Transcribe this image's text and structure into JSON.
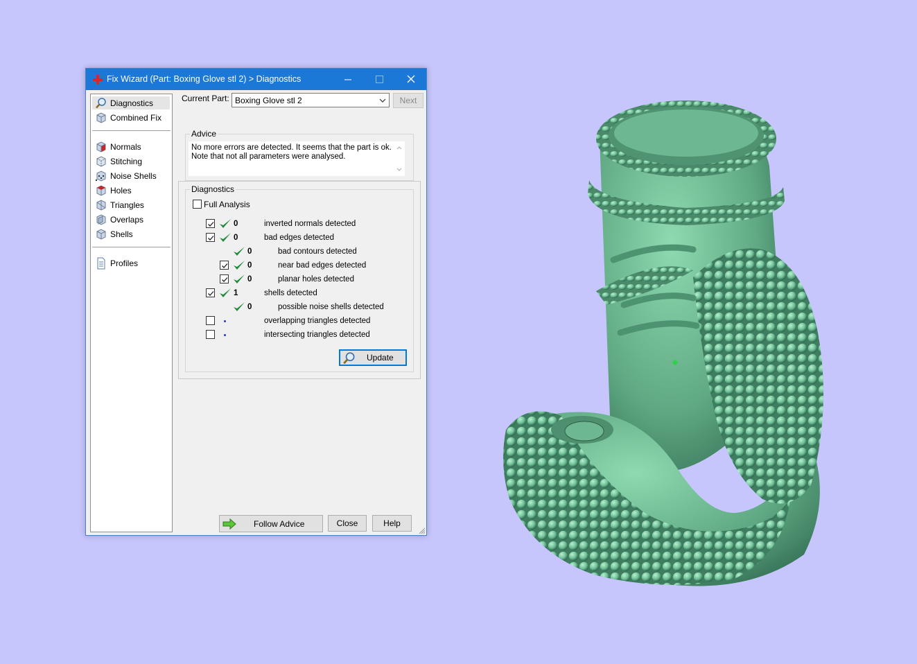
{
  "colors": {
    "desktop": "#c6c6fc",
    "titlebar": "#1b78d6",
    "model": "#6fbf97",
    "check_green": "#1f8a3b"
  },
  "window": {
    "title": "Fix Wizard (Part: Boxing Glove stl 2) > Diagnostics",
    "controls": [
      "minimize-icon",
      "maximize-icon",
      "close-icon"
    ]
  },
  "sidebar": {
    "items": [
      {
        "label": "Diagnostics",
        "icon": "magnifier-icon",
        "selected": true
      },
      {
        "label": "Combined Fix",
        "icon": "cube-icon"
      },
      {
        "label": "Normals",
        "icon": "cube-red-face-icon"
      },
      {
        "label": "Stitching",
        "icon": "cube-stitch-icon"
      },
      {
        "label": "Noise Shells",
        "icon": "cube-dots-icon"
      },
      {
        "label": "Holes",
        "icon": "cube-red-hole-icon"
      },
      {
        "label": "Triangles",
        "icon": "triangle-cube-icon"
      },
      {
        "label": "Overlaps",
        "icon": "cube-overlap-icon"
      },
      {
        "label": "Shells",
        "icon": "cube-shells-icon"
      },
      {
        "label": "Profiles",
        "icon": "document-icon"
      }
    ]
  },
  "current_part": {
    "label": "Current Part:",
    "value": "Boxing Glove stl 2",
    "next_label": "Next"
  },
  "advice": {
    "title": "Advice",
    "text_line1": "No more errors are detected. It seems that the part is ok.",
    "text_line2": "Note that not all parameters were analysed."
  },
  "diagnostics": {
    "title": "Diagnostics",
    "full_analysis_label": "Full Analysis",
    "full_analysis_checked": false,
    "rows": [
      {
        "checked": true,
        "status": "ok",
        "count": "0",
        "label": "inverted normals detected",
        "level": 0,
        "has_checkbox": true
      },
      {
        "checked": true,
        "status": "ok",
        "count": "0",
        "label": "bad edges detected",
        "level": 0,
        "has_checkbox": true
      },
      {
        "checked": false,
        "status": "ok",
        "count": "0",
        "label": "bad contours detected",
        "level": 1,
        "has_checkbox": false
      },
      {
        "checked": true,
        "status": "ok",
        "count": "0",
        "label": "near bad edges detected",
        "level": 1,
        "has_checkbox": true
      },
      {
        "checked": true,
        "status": "ok",
        "count": "0",
        "label": "planar holes detected",
        "level": 1,
        "has_checkbox": true
      },
      {
        "checked": true,
        "status": "ok",
        "count": "1",
        "label": "shells detected",
        "level": 0,
        "has_checkbox": true
      },
      {
        "checked": false,
        "status": "ok",
        "count": "0",
        "label": "possible noise shells detected",
        "level": 1,
        "has_checkbox": false
      },
      {
        "checked": false,
        "status": "pending",
        "count": "",
        "label": "overlapping triangles detected",
        "level": 0,
        "has_checkbox": true
      },
      {
        "checked": false,
        "status": "pending",
        "count": "",
        "label": "intersecting triangles detected",
        "level": 0,
        "has_checkbox": true
      }
    ],
    "update_label": "Update"
  },
  "footer": {
    "follow_advice_label": "Follow Advice",
    "close_label": "Close",
    "help_label": "Help"
  }
}
